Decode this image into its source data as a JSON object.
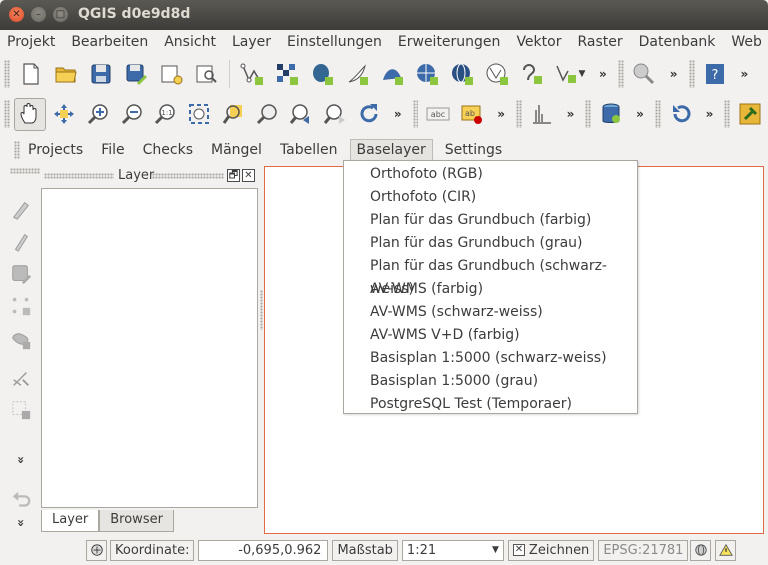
{
  "window": {
    "title": "QGIS d0e9d8d"
  },
  "menubar": [
    "Projekt",
    "Bearbeiten",
    "Ansicht",
    "Layer",
    "Einstellungen",
    "Erweiterungen",
    "Vektor",
    "Raster",
    "Datenbank",
    "Web"
  ],
  "toolbar1": {
    "icons": [
      "new-project-icon",
      "open-project-icon",
      "save-project-icon",
      "save-as-icon",
      "new-print-composer-icon",
      "composer-manager-icon",
      "add-vector-layer-icon",
      "add-raster-layer-icon",
      "add-postgis-layer-icon",
      "add-spatialite-layer-icon",
      "add-mssql-layer-icon",
      "add-wms-layer-icon",
      "add-wcs-layer-icon",
      "add-wfs-layer-icon",
      "add-delimited-text-icon",
      "new-layer-dropdown-icon",
      "identify-icon",
      "help-icon"
    ],
    "overflow": "»"
  },
  "toolbar2": {
    "icons": [
      "pan-icon",
      "pan-to-selection-icon",
      "zoom-in-icon",
      "zoom-out-icon",
      "zoom-actual-size-icon",
      "zoom-full-icon",
      "zoom-to-selection-icon",
      "zoom-to-layer-icon",
      "zoom-last-icon",
      "zoom-next-icon",
      "refresh-icon",
      "label-icon",
      "label-pin-icon",
      "histogram-icon",
      "db-manager-icon",
      "undo-plugin-icon",
      "plugin-icon"
    ],
    "label_text": [
      "abc",
      "ab"
    ],
    "overflow": "»"
  },
  "pluginbar": {
    "items": [
      "Projects",
      "File",
      "Checks",
      "Mängel",
      "Tabellen",
      "Baselayer",
      "Settings"
    ],
    "active": "Baselayer"
  },
  "dropdown": {
    "items": [
      "Orthofoto (RGB)",
      "Orthofoto (CIR)",
      "Plan für das Grundbuch (farbig)",
      "Plan für das Grundbuch (grau)",
      "Plan für das Grundbuch (schwarz-weiss)",
      "AV-WMS (farbig)",
      "AV-WMS (schwarz-weiss)",
      "AV-WMS V+D (farbig)",
      "Basisplan 1:5000 (schwarz-weiss)",
      "Basisplan 1:5000 (grau)",
      "PostgreSQL Test (Temporaer)"
    ]
  },
  "layer_panel": {
    "title": "Layer",
    "float_glyph": "🗗",
    "close_glyph": "✕",
    "tabs": [
      "Layer",
      "Browser"
    ]
  },
  "vtoolbar": {
    "icons": [
      "digitize-icon",
      "edit-pencil-icon",
      "save-edits-icon",
      "add-feature-icon",
      "move-feature-icon",
      "node-tool-icon",
      "delete-selected-icon",
      "more-icon",
      "undo-icon",
      "more-icon"
    ],
    "more_glyph": "»"
  },
  "statusbar": {
    "coord_label": "Koordinate:",
    "coord_value": "-0,695,0.962",
    "scale_label": "Maßstab",
    "scale_value": "1:21",
    "render_label": "Zeichnen",
    "epsg": "EPSG:21781"
  },
  "colors": {
    "accent_orange": "#e06a44",
    "title_bg": "#3d3c38",
    "window_bg": "#f2f1f0"
  }
}
